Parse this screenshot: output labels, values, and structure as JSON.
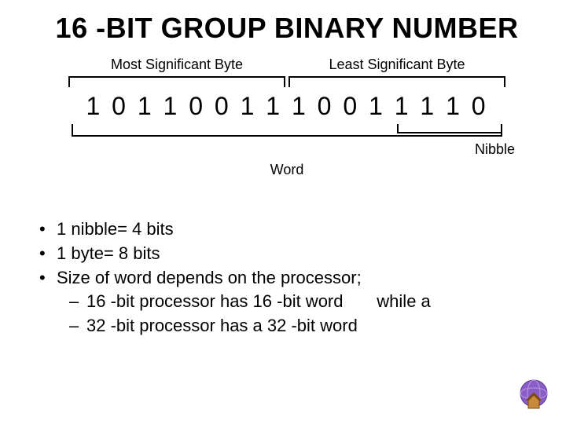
{
  "title": "16 -BIT GROUP BINARY NUMBER",
  "labels": {
    "msb": "Most Significant Byte",
    "lsb": "Least Significant Byte",
    "nibble": "Nibble",
    "word": "Word"
  },
  "bits": "1 0 1 1 0 0 1 1 1 0 0 1 1 1 1 0",
  "bullets": {
    "b1": "1 nibble= 4 bits",
    "b2": "1 byte= 8 bits",
    "b3": "Size of word depends on the processor;",
    "s1a": "16 -bit processor has 16 -bit word",
    "s1b": "while a",
    "s2": "32 -bit processor has a 32 -bit word"
  },
  "chart_data": {
    "type": "table",
    "title": "16-bit binary word structure",
    "bits": [
      1,
      0,
      1,
      1,
      0,
      0,
      1,
      1,
      1,
      0,
      0,
      1,
      1,
      1,
      1,
      0
    ],
    "groupings": [
      {
        "name": "Most Significant Byte",
        "bit_indices": [
          0,
          1,
          2,
          3,
          4,
          5,
          6,
          7
        ]
      },
      {
        "name": "Least Significant Byte",
        "bit_indices": [
          8,
          9,
          10,
          11,
          12,
          13,
          14,
          15
        ]
      },
      {
        "name": "Nibble",
        "bit_indices": [
          12,
          13,
          14,
          15
        ]
      },
      {
        "name": "Word",
        "bit_indices": [
          0,
          1,
          2,
          3,
          4,
          5,
          6,
          7,
          8,
          9,
          10,
          11,
          12,
          13,
          14,
          15
        ]
      }
    ],
    "definitions": {
      "nibble_bits": 4,
      "byte_bits": 8,
      "word_bits_examples": [
        16,
        32
      ]
    }
  }
}
